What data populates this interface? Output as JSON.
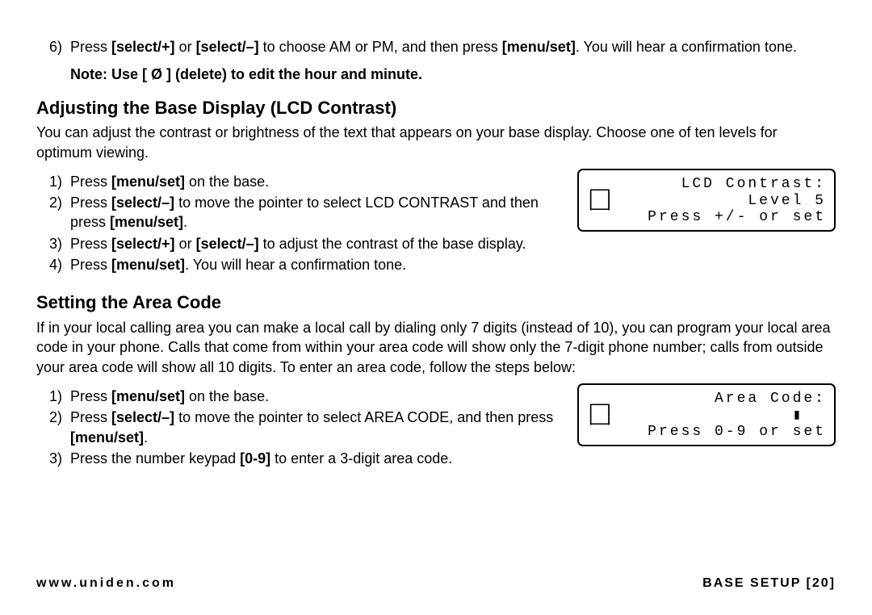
{
  "top_step": {
    "num": "6)",
    "pre": "Press ",
    "b1": "[select/+]",
    "mid1": " or ",
    "b2": "[select/–]",
    "mid2": " to choose AM or PM, and then press ",
    "b3": "[menu/set]",
    "post": ". You will hear a confirmation tone."
  },
  "note": "Note: Use [ Ø ] (delete) to edit the hour and minute.",
  "section1": {
    "heading": "Adjusting the Base Display (LCD Contrast)",
    "para": "You can adjust the contrast or brightness of the text that appears on your base display. Choose one of ten levels for optimum viewing.",
    "steps": [
      {
        "num": "1)",
        "pre": "Press ",
        "b1": "[menu/set]",
        "post": " on the base."
      },
      {
        "num": "2)",
        "pre": "Press ",
        "b1": "[select/–]",
        "mid1": " to move the pointer to select LCD CONTRAST and then press ",
        "b2": "[menu/set]",
        "post": "."
      },
      {
        "num": "3)",
        "pre": "Press ",
        "b1": "[select/+]",
        "mid1": " or ",
        "b2": "[select/–]",
        "post": " to adjust the contrast of the base display."
      },
      {
        "num": "4)",
        "pre": "Press ",
        "b1": "[menu/set]",
        "post": ". You will hear a confirmation tone."
      }
    ],
    "lcd": {
      "line1": "LCD Contrast:",
      "line2": "Level 5",
      "line3": "Press +/- or set"
    }
  },
  "section2": {
    "heading": "Setting the Area Code",
    "para": "If in your local calling area you can make a local call by dialing only 7 digits (instead of 10), you can program your local area code in your phone. Calls that come from within your area code will show only the 7-digit phone number; calls from outside your area code will show all 10 digits. To enter an area code, follow the steps below:",
    "steps": [
      {
        "num": "1)",
        "pre": "Press ",
        "b1": "[menu/set]",
        "post": " on the base."
      },
      {
        "num": "2)",
        "pre": "Press ",
        "b1": "[select/–]",
        "mid1": " to move the pointer to select AREA CODE, and then press ",
        "b2": "[menu/set]",
        "post": "."
      },
      {
        "num": "3)",
        "pre": "Press the number keypad ",
        "b1": "[0-9]",
        "post": " to enter a 3-digit area code."
      }
    ],
    "lcd": {
      "line1": "Area Code:",
      "line2": "▮  ",
      "line3": "Press 0-9 or set"
    }
  },
  "glyph": "┌─┐\n│ │\n└─┘",
  "footer": {
    "left": "www.uniden.com",
    "right": "BASE SETUP [20]"
  }
}
